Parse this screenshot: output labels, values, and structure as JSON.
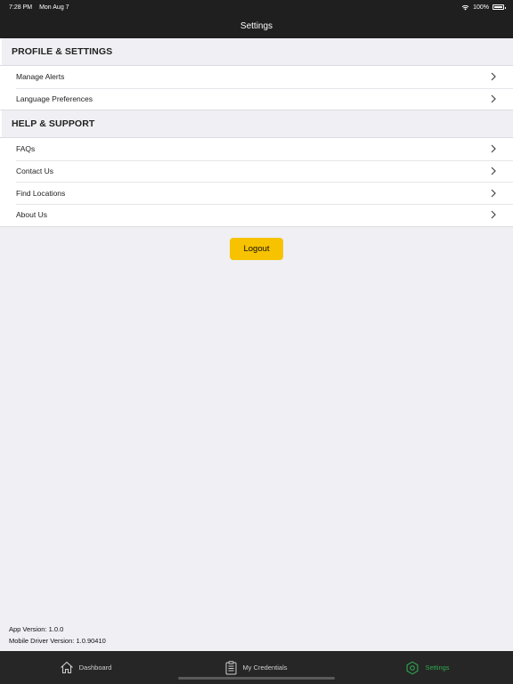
{
  "status_bar": {
    "time": "7:28 PM",
    "date": "Mon Aug 7",
    "battery": "100%",
    "battery_level": 1.0
  },
  "nav": {
    "title": "Settings"
  },
  "sections": [
    {
      "title": "PROFILE & SETTINGS",
      "items": [
        "Manage Alerts",
        "Language Preferences"
      ]
    },
    {
      "title": "HELP & SUPPORT",
      "items": [
        "FAQs",
        "Contact Us",
        "Find Locations",
        "About Us"
      ]
    }
  ],
  "logout_label": "Logout",
  "version": {
    "app": "App Version:  1.0.0",
    "driver": "Mobile Driver Version:  1.0.90410"
  },
  "tabs": [
    {
      "label": "Dashboard",
      "icon": "house-icon",
      "active": false
    },
    {
      "label": "My Credentials",
      "icon": "clipboard-icon",
      "active": false
    },
    {
      "label": "Settings",
      "icon": "gear-icon",
      "active": true
    }
  ],
  "colors": {
    "accent_yellow": "#f7c200",
    "active_tab": "#2fa84f",
    "bar_dark": "#1f1f1f"
  }
}
